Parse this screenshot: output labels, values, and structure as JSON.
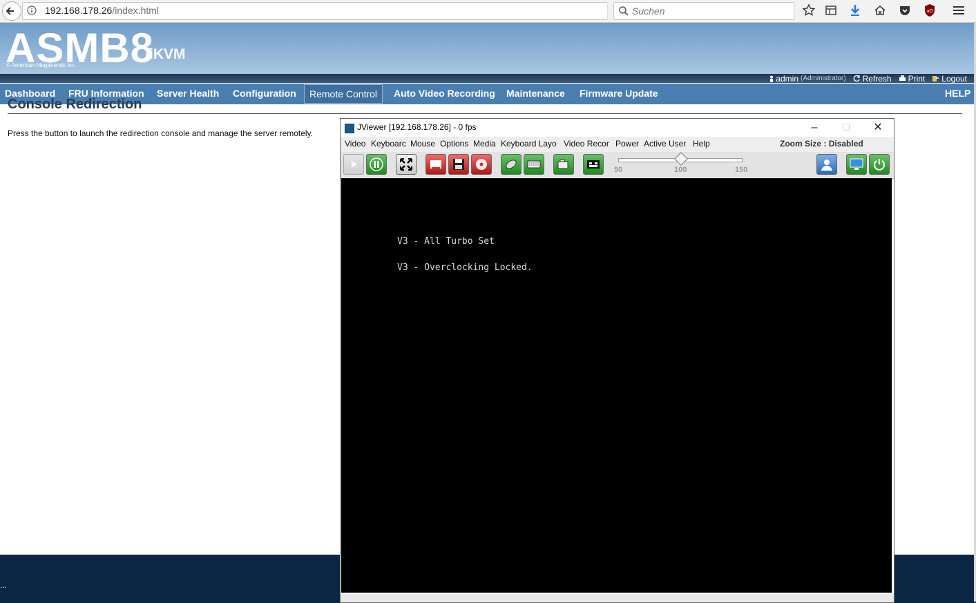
{
  "browser": {
    "url_host": "192.168.178.26",
    "url_path": "/index.html",
    "search_placeholder": "Suchen"
  },
  "app": {
    "logo_main": "ASMB8",
    "logo_sub": "iKVM",
    "logo_copyright": "© American Megatrends Inc."
  },
  "userbar": {
    "user": "admin",
    "role": "(Administrator)",
    "refresh": "Refresh",
    "print": "Print",
    "logout": "Logout"
  },
  "menu": {
    "items": [
      "Dashboard",
      "FRU Information",
      "Server Health",
      "Configuration",
      "Remote Control",
      "Auto Video Recording",
      "Maintenance",
      "Firmware Update"
    ],
    "help": "HELP",
    "active": "Remote Control"
  },
  "content": {
    "title": "Console Redirection",
    "description": "Press the button to launch the redirection console and manage the server remotely."
  },
  "jviewer": {
    "title": "JViewer [192.168.178.26] - 0 fps",
    "menu": [
      "Video",
      "Keyboard",
      "Mouse",
      "Options",
      "Media",
      "Keyboard Layout",
      "Video Record",
      "Power",
      "Active User",
      "Help"
    ],
    "menu_visible": [
      "Video",
      "Keyboarc",
      "Mouse",
      "Options",
      "Media",
      "Keyboard Layo",
      "Video Recor",
      "Power",
      "Active User",
      "Help"
    ],
    "zoom_label": "Zoom Size :",
    "zoom_value": "Disabled",
    "zoom_ticks": [
      "50",
      "100",
      "150"
    ],
    "zoom_level": 100,
    "console_lines": [
      "V3 - All Turbo Set",
      "V3 - Overclocking Locked."
    ]
  },
  "colors": {
    "menubar": "#4b7eb0",
    "header": "#8fb3d9",
    "desktop": "#0b2545"
  },
  "taskbar": {
    "text": "..."
  }
}
